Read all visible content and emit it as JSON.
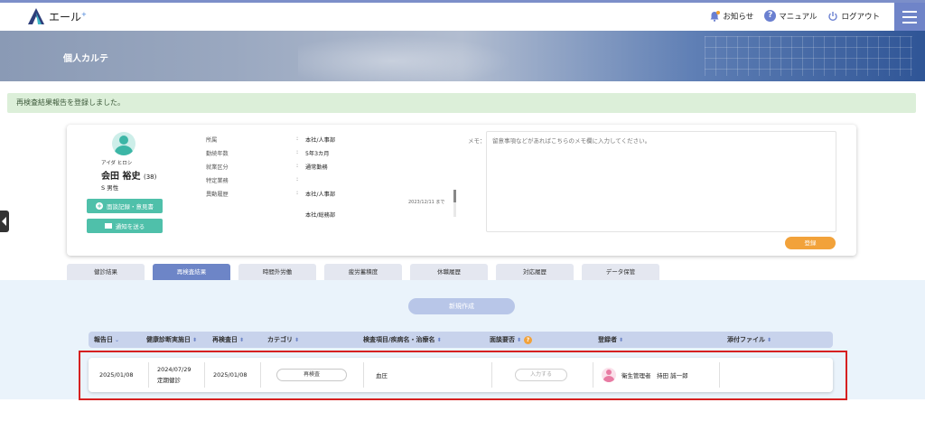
{
  "header": {
    "logo_text": "エール",
    "logo_plus": "+",
    "notifications_label": "お知らせ",
    "manual_label": "マニュアル",
    "logout_label": "ログアウト"
  },
  "banner": {
    "title": "個人カルテ"
  },
  "notice": {
    "message": "再検査結果報告を登録しました。"
  },
  "profile": {
    "kana": "アイダ ヒロシ",
    "name": "会田 裕史",
    "age": "(38)",
    "gender": "S 男性",
    "interview_button": "面談記録・意見書",
    "notify_button": "通知を送る",
    "fields": [
      {
        "label": "所属",
        "sep": ":",
        "value": "本社/人事部"
      },
      {
        "label": "勤続年数",
        "sep": ":",
        "value": "5年3カ月"
      },
      {
        "label": "就業区分",
        "sep": ":",
        "value": "通常勤務"
      },
      {
        "label": "特定業務",
        "sep": ":",
        "value": ""
      },
      {
        "label": "異動履歴",
        "sep": ":",
        "value": "本社/人事部"
      }
    ],
    "history_until": "2023/12/11 まで",
    "history_next": "本社/総務部",
    "memo_label": "メモ：",
    "memo_placeholder": "留意事項などがあればこちらのメモ欄に入力してください。",
    "register_button": "登録"
  },
  "tabs": [
    {
      "label": "健診結果",
      "active": false
    },
    {
      "label": "再検査結果",
      "active": true
    },
    {
      "label": "時間外労働",
      "active": false
    },
    {
      "label": "疲労蓄積度",
      "active": false
    },
    {
      "label": "休職履歴",
      "active": false
    },
    {
      "label": "対応履歴",
      "active": false
    },
    {
      "label": "データ保管",
      "active": false
    }
  ],
  "content": {
    "new_button": "新規作成",
    "columns": [
      {
        "label": "報告日",
        "sort": "⌄"
      },
      {
        "label": "健康診断実施日",
        "sort": "⬍"
      },
      {
        "label": "再検査日",
        "sort": "⬍"
      },
      {
        "label": "カテゴリ",
        "sort": "⬍"
      },
      {
        "label": "検査項目/疾病名・治療名",
        "sort": "⬍"
      },
      {
        "label": "面談要否",
        "sort": "⬍"
      },
      {
        "label": "登録者",
        "sort": "⬍"
      },
      {
        "label": "添付ファイル",
        "sort": "⬍"
      }
    ],
    "help_icon": "?",
    "row": {
      "report_date": "2025/01/08",
      "exam_date": "2024/07/29",
      "exam_type": "定期健診",
      "recheck_date": "2025/01/08",
      "category": "再検査",
      "item": "血圧",
      "interview_input": "入力する",
      "registrant": "衛生管理者　持田 誠一郎",
      "attachment": ""
    }
  },
  "colors": {
    "accent": "#6d85c7",
    "teal": "#4fc0aa",
    "orange": "#f2a23a",
    "highlight": "#d62020"
  }
}
